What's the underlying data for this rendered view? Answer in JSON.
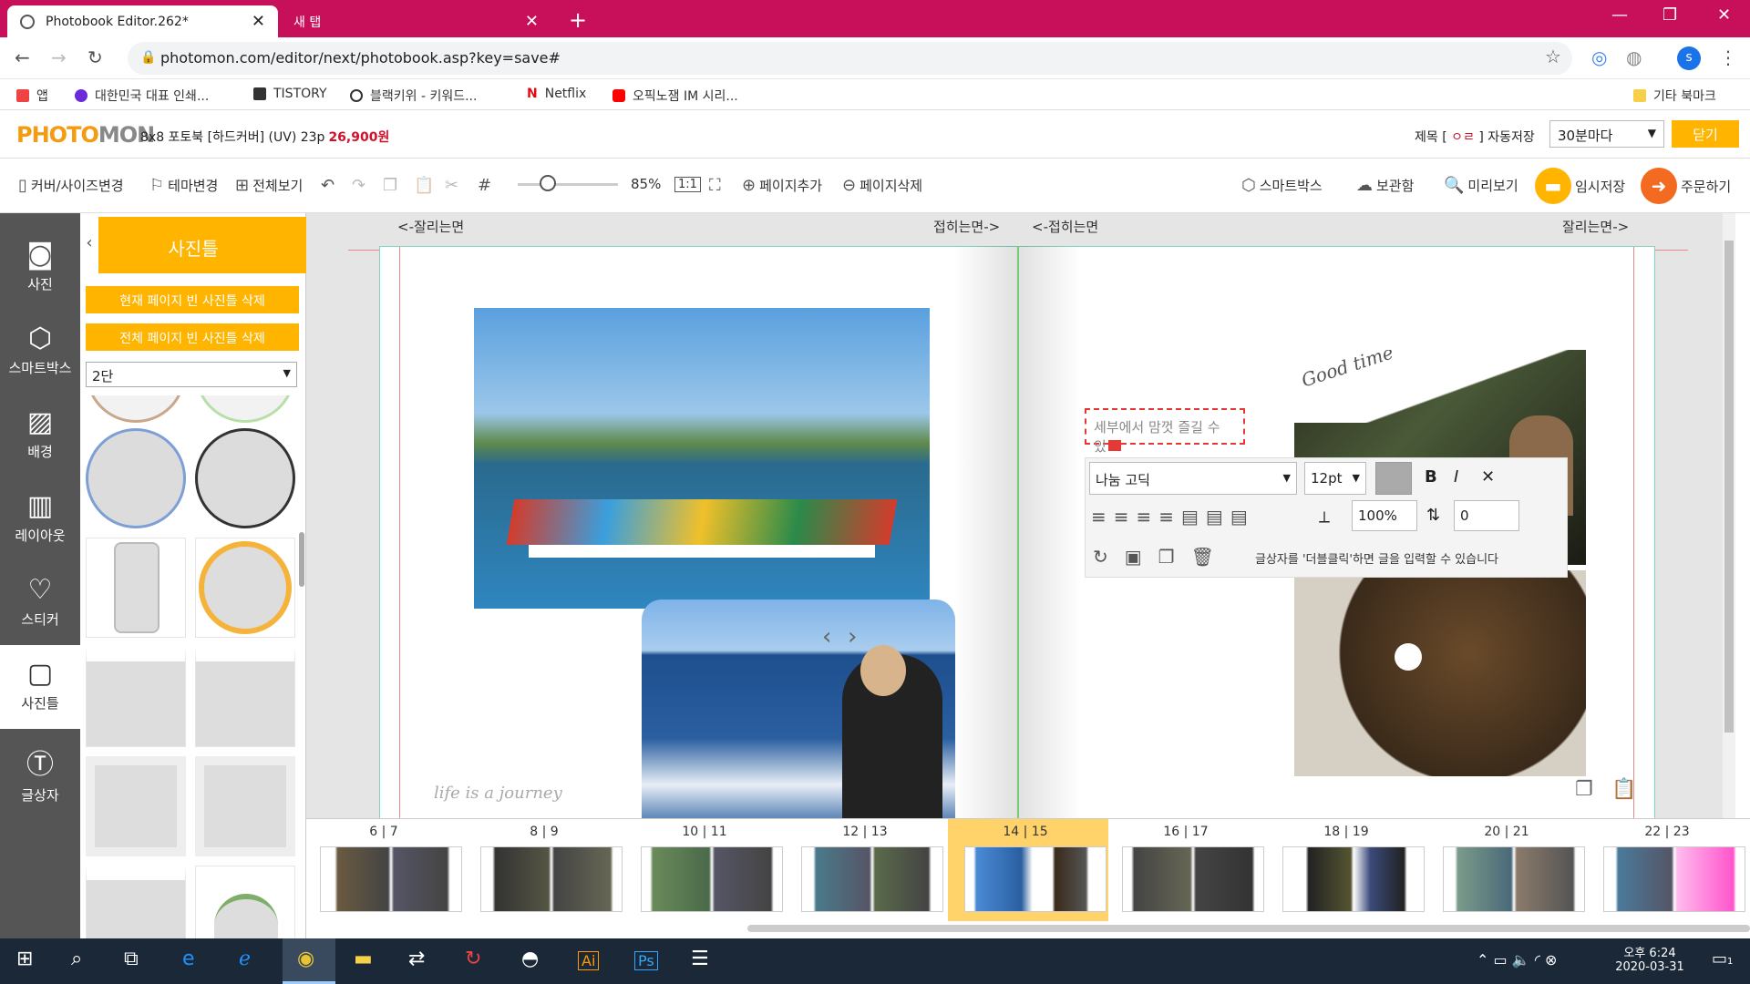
{
  "browser": {
    "tabs": [
      {
        "label": "Photobook Editor.262*"
      },
      {
        "label": "새 탭"
      }
    ],
    "url": "photomon.com/editor/next/photobook.asp?key=save#"
  },
  "bookmarks": [
    "앱",
    "대한민국 대표 인쇄...",
    "TISTORY",
    "블랙키위 - 키워드...",
    "Netflix",
    "오픽노잼 IM 시리...",
    "기타 북마크"
  ],
  "app": {
    "logo_a": "PHOTO",
    "logo_b": "MON",
    "product": "8x8 포토북 [하드커버] (UV) 23p",
    "price": "26,900원",
    "title_label": "제목 [",
    "title_value": "ㅇㄹ",
    "title_end": "]",
    "autosave_label": "자동저장",
    "autosave_value": "30분마다",
    "close": "닫기"
  },
  "toolbar": {
    "cover": "커버/사이즈변경",
    "theme": "테마변경",
    "full": "전체보기",
    "zoom": "85%",
    "ratio": "1:1",
    "add_page": "페이지추가",
    "del_page": "페이지삭제",
    "smartbox": "스마트박스",
    "storage": "보관함",
    "preview": "미리보기",
    "temp_save": "임시저장",
    "order": "주문하기"
  },
  "rail": [
    "사진",
    "스마트박스",
    "배경",
    "레이아웃",
    "스티커",
    "사진틀",
    "글상자"
  ],
  "panel": {
    "title": "사진틀",
    "btn1": "현재 페이지 빈 사진틀 삭제",
    "btn2": "전체 페이지 빈 사진틀 삭제",
    "columns": "2단"
  },
  "guides": {
    "cut_left": "<-잘리는면",
    "fold_left": "접히는면->",
    "fold_right": "<-접히는면",
    "cut_right": "잘리는면->"
  },
  "textbox": {
    "text": "세부에서 맘껏 즐길 수 있",
    "font": "나눔 고딕",
    "size": "12pt",
    "scale": "100%",
    "spacing": "0",
    "hint": "글상자를 '더블클릭'하면 글을 입력할 수 있습니다"
  },
  "photo_caption": "Good time",
  "left_caption": "life is a journey",
  "spreads": [
    "6 | 7",
    "8 | 9",
    "10 | 11",
    "12 | 13",
    "14 | 15",
    "16 | 17",
    "18 | 19",
    "20 | 21",
    "22 | 23"
  ],
  "clock": {
    "time": "오후 6:24",
    "date": "2020-03-31"
  },
  "notif": "1"
}
